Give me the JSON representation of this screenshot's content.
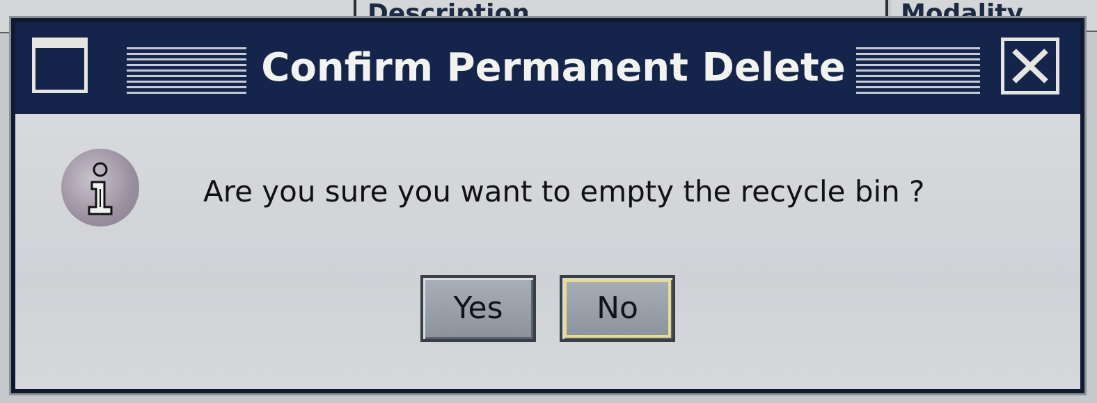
{
  "background": {
    "columns": [
      {
        "label": ""
      },
      {
        "label": "Description"
      },
      {
        "label": "Modality"
      }
    ]
  },
  "dialog": {
    "title": "Confirm Permanent Delete",
    "icon": "info-icon",
    "message": "Are you sure you want to empty the recycle bin ?",
    "buttons": {
      "yes_label": "Yes",
      "no_label": "No",
      "focused": "No"
    },
    "colors": {
      "titlebar": "#14244a",
      "focus_ring": "#e7dc8a"
    }
  }
}
